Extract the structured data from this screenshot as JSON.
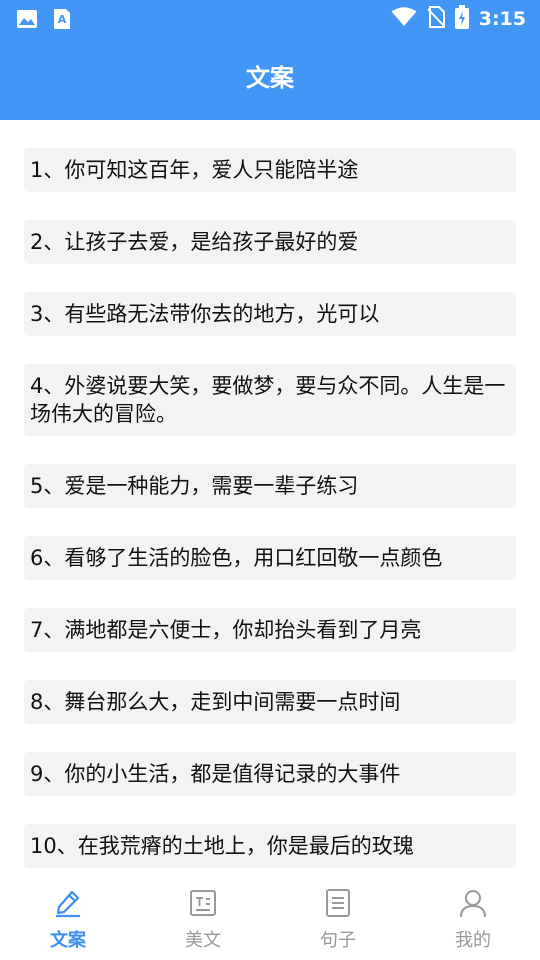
{
  "status_bar": {
    "time": "3:15"
  },
  "header": {
    "title": "文案"
  },
  "list": {
    "items": [
      "1、你可知这百年，爱人只能陪半途",
      "2、让孩子去爱，是给孩子最好的爱",
      "3、有些路无法带你去的地方，光可以",
      "4、外婆说要大笑，要做梦，要与众不同。人生是一场伟大的冒险。",
      "5、爱是一种能力，需要一辈子练习",
      "6、看够了生活的脸色，用口红回敬一点颜色",
      "7、满地都是六便士，你却抬头看到了月亮",
      "8、舞台那么大，走到中间需要一点时间",
      "9、你的小生活，都是值得记录的大事件",
      "10、在我荒瘠的土地上，你是最后的玫瑰"
    ]
  },
  "bottom_nav": {
    "tabs": [
      {
        "label": "文案",
        "icon": "pen-icon",
        "active": true
      },
      {
        "label": "美文",
        "icon": "article-icon",
        "active": false
      },
      {
        "label": "句子",
        "icon": "document-icon",
        "active": false
      },
      {
        "label": "我的",
        "icon": "user-icon",
        "active": false
      }
    ]
  },
  "colors": {
    "primary": "#4297f6",
    "active_tab": "#3d8ff0",
    "inactive_tab": "#999999",
    "card_bg": "#f3f3f3"
  }
}
